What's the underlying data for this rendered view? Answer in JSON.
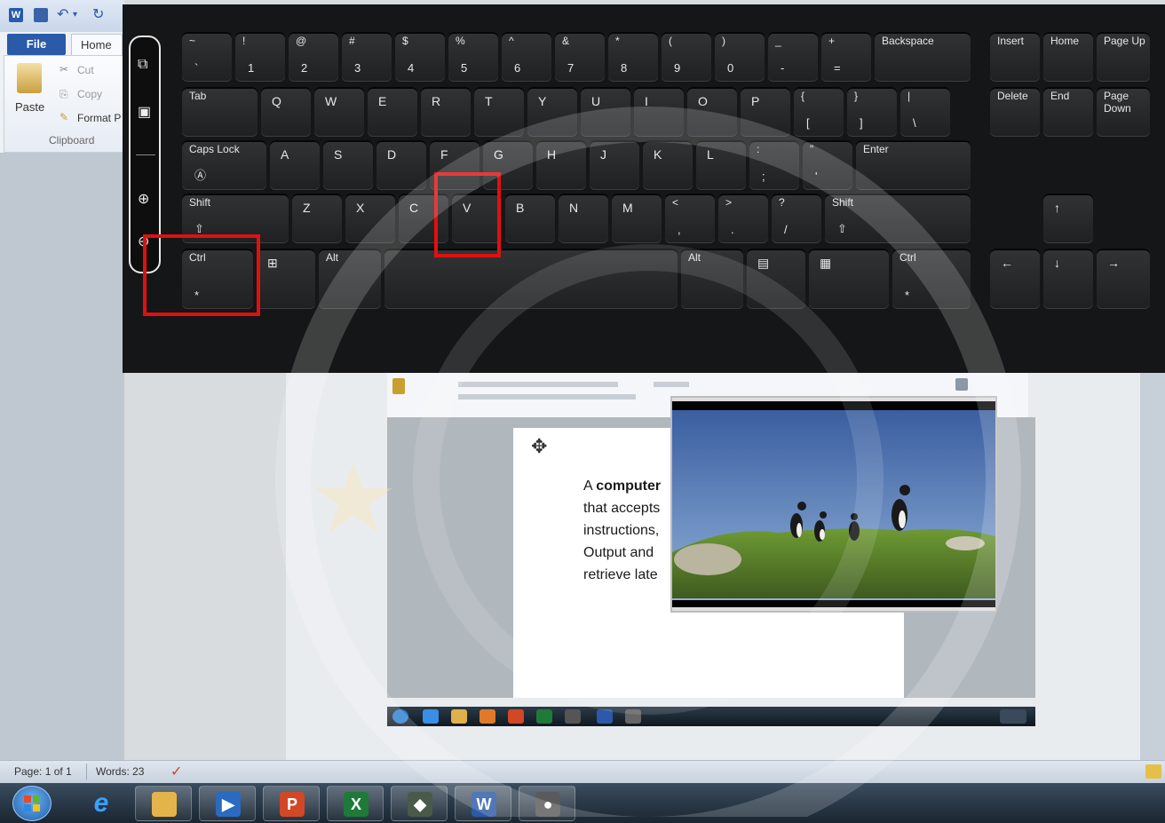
{
  "word": {
    "file_tab": "File",
    "home_tab": "Home",
    "clipboard": {
      "paste": "Paste",
      "cut": "Cut",
      "copy": "Copy",
      "format_painter": "Format P",
      "group_label": "Clipboard"
    },
    "status": {
      "page": "Page: 1 of 1",
      "words": "Words: 23"
    }
  },
  "keyboard": {
    "row1": [
      {
        "top": "~",
        "bottom": "`"
      },
      {
        "top": "!",
        "bottom": "1"
      },
      {
        "top": "@",
        "bottom": "2"
      },
      {
        "top": "#",
        "bottom": "3"
      },
      {
        "top": "$",
        "bottom": "4"
      },
      {
        "top": "%",
        "bottom": "5"
      },
      {
        "top": "^",
        "bottom": "6"
      },
      {
        "top": "&",
        "bottom": "7"
      },
      {
        "top": "*",
        "bottom": "8"
      },
      {
        "top": "(",
        "bottom": "9"
      },
      {
        "top": ")",
        "bottom": "0"
      },
      {
        "top": "_",
        "bottom": "-"
      },
      {
        "top": "+",
        "bottom": "="
      }
    ],
    "backspace": "Backspace",
    "tab": "Tab",
    "row2": [
      "Q",
      "W",
      "E",
      "R",
      "T",
      "Y",
      "U",
      "I",
      "O",
      "P"
    ],
    "row2_brackets": [
      {
        "top": "{",
        "bottom": "["
      },
      {
        "top": "}",
        "bottom": "]"
      },
      {
        "top": "|",
        "bottom": "\\"
      }
    ],
    "caps_lock": "Caps Lock",
    "row3": [
      "A",
      "S",
      "D",
      "F",
      "G",
      "H",
      "J",
      "K",
      "L"
    ],
    "row3_punct": [
      {
        "top": ":",
        "bottom": ";"
      },
      {
        "top": "\"",
        "bottom": "'"
      }
    ],
    "enter": "Enter",
    "shift": "Shift",
    "row4": [
      "Z",
      "X",
      "C",
      "V",
      "B",
      "N",
      "M"
    ],
    "row4_punct": [
      {
        "top": "<",
        "bottom": ","
      },
      {
        "top": ">",
        "bottom": "."
      },
      {
        "top": "?",
        "bottom": "/"
      }
    ],
    "ctrl": "Ctrl",
    "alt": "Alt",
    "nav": {
      "insert": "Insert",
      "home": "Home",
      "page_up": "Page Up",
      "delete": "Delete",
      "end": "End",
      "page_down": "Page Down"
    },
    "highlight_color": "#e01010"
  },
  "document": {
    "lines": [
      {
        "pre": "A ",
        "bold": "computer",
        "post": ""
      },
      {
        "pre": "that accepts",
        "bold": "",
        "post": ""
      },
      {
        "pre": "instructions,",
        "bold": "",
        "post": ""
      },
      {
        "pre": "Output  and",
        "bold": "",
        "post": ""
      },
      {
        "pre": "retrieve late",
        "bold": "",
        "post": ""
      }
    ]
  }
}
